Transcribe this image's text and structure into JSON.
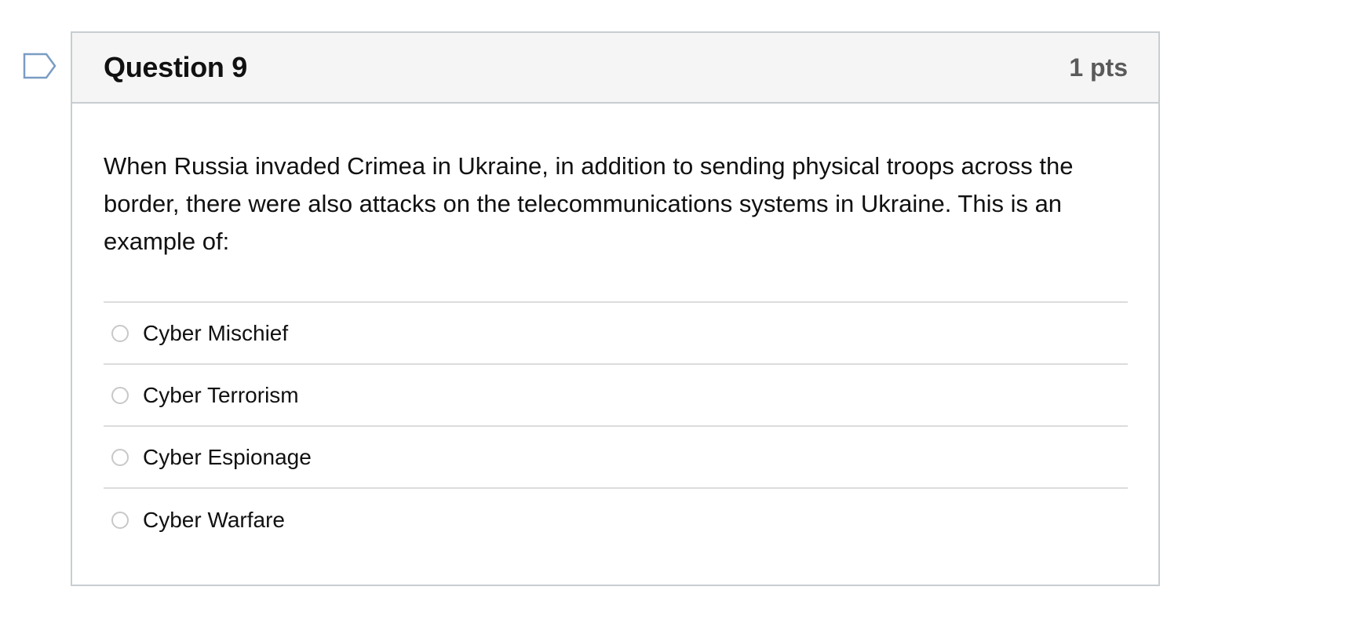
{
  "question": {
    "title": "Question 9",
    "points": "1 pts",
    "text": "When Russia invaded Crimea in Ukraine, in addition to sending physical troops across the border, there were also attacks on the telecommunications systems in Ukraine. This is an example of:",
    "answers": [
      {
        "label": "Cyber Mischief"
      },
      {
        "label": "Cyber Terrorism"
      },
      {
        "label": "Cyber Espionage"
      },
      {
        "label": "Cyber Warfare"
      }
    ]
  },
  "icons": {
    "flag": "flag-question-icon"
  },
  "colors": {
    "flag_stroke": "#7a9cc4",
    "header_bg": "#f5f5f5",
    "border": "#c7cdd1"
  }
}
